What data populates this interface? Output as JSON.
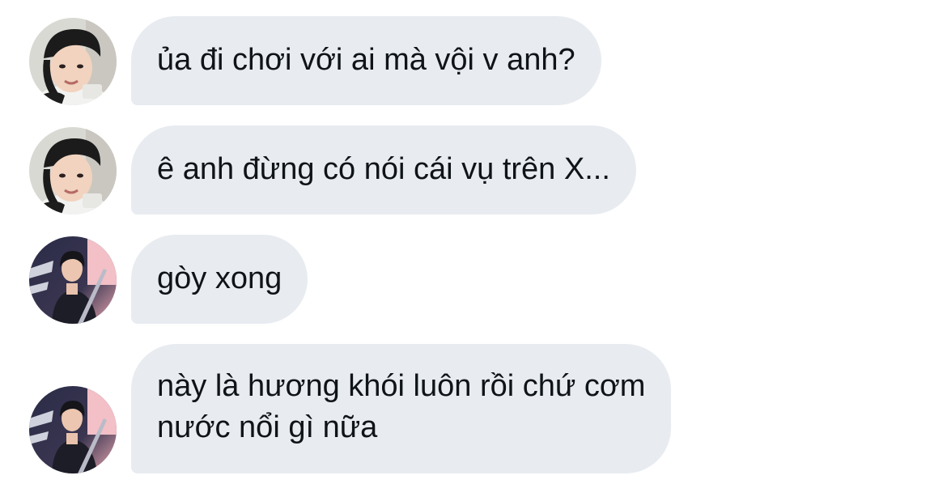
{
  "colors": {
    "bubble_bg": "#e8ebf0",
    "text": "#0f1419",
    "background": "#ffffff"
  },
  "messages": [
    {
      "avatar": "avatar-1",
      "lines": [
        "ủa đi chơi với ai mà vội v anh?"
      ]
    },
    {
      "avatar": "avatar-1",
      "lines": [
        "ê anh đừng có nói cái vụ trên X..."
      ]
    },
    {
      "avatar": "avatar-2",
      "lines": [
        "gòy xong"
      ]
    },
    {
      "avatar": "avatar-2",
      "lines": [
        "này là hương khói luôn rồi chứ cơm",
        "nước nổi gì nữa"
      ]
    }
  ]
}
